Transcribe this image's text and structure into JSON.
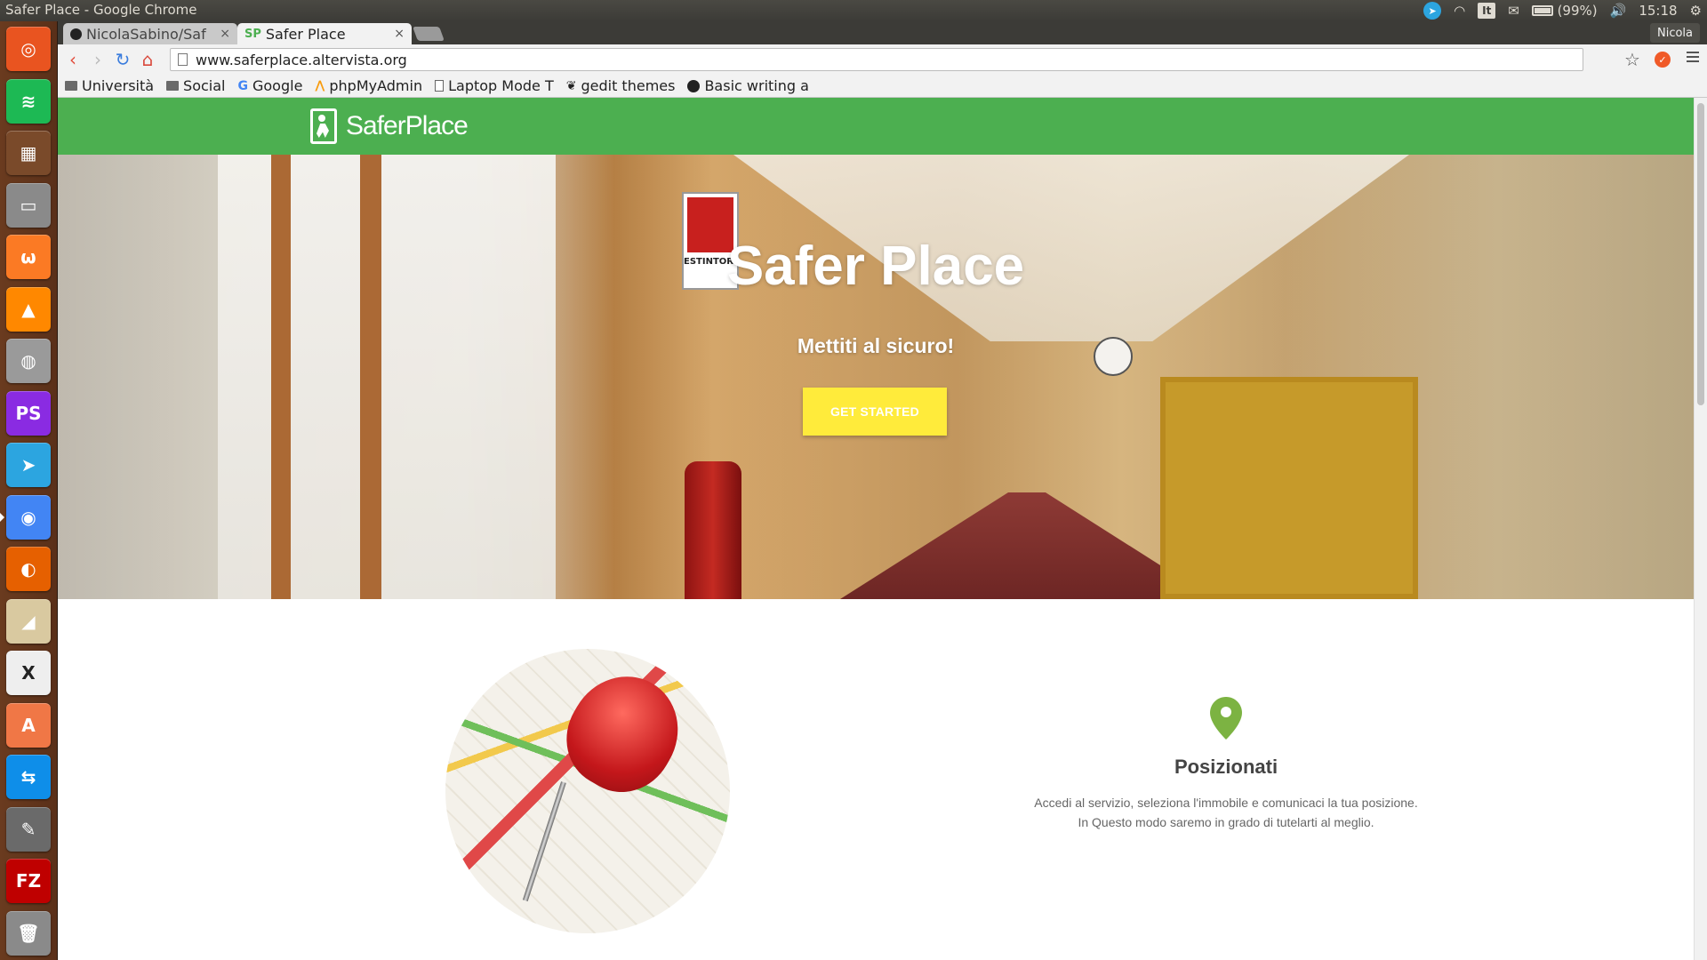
{
  "os": {
    "window_title": "Safer Place - Google Chrome",
    "battery": "(99%)",
    "clock": "15:18",
    "keyboard_layout": "It",
    "user": "Nicola"
  },
  "launcher": {
    "items": [
      {
        "name": "ubuntu-dash-icon",
        "color": "#e95420",
        "glyph": "◎"
      },
      {
        "name": "spotify-icon",
        "color": "#1db954",
        "glyph": "≋"
      },
      {
        "name": "workspace-switcher-icon",
        "color": "#7a4a2a",
        "glyph": "▦"
      },
      {
        "name": "files-icon",
        "color": "#8a8a8a",
        "glyph": "▭"
      },
      {
        "name": "xampp-icon",
        "color": "#fb7a24",
        "glyph": "ω"
      },
      {
        "name": "vlc-icon",
        "color": "#ff8800",
        "glyph": "▲"
      },
      {
        "name": "disk-icon",
        "color": "#9a9a9a",
        "glyph": "◍"
      },
      {
        "name": "phpstorm-icon",
        "color": "#8a2be2",
        "glyph": "PS"
      },
      {
        "name": "telegram-icon",
        "color": "#2ca5e0",
        "glyph": "➤"
      },
      {
        "name": "chrome-icon",
        "color": "#4285f4",
        "glyph": "◉"
      },
      {
        "name": "firefox-icon",
        "color": "#e66000",
        "glyph": "◐"
      },
      {
        "name": "impress-icon",
        "color": "#d9c9a0",
        "glyph": "◢"
      },
      {
        "name": "xmind-icon",
        "color": "#eeeeee",
        "glyph": "X"
      },
      {
        "name": "software-center-icon",
        "color": "#f07746",
        "glyph": "A"
      },
      {
        "name": "teamviewer-icon",
        "color": "#0e8ee9",
        "glyph": "⇆"
      },
      {
        "name": "tools-icon",
        "color": "#6a6a6a",
        "glyph": "✎"
      },
      {
        "name": "filezilla-icon",
        "color": "#bf0000",
        "glyph": "FZ"
      },
      {
        "name": "trash-icon",
        "color": "#8a8a8a",
        "glyph": "🗑"
      }
    ]
  },
  "browser": {
    "tabs": [
      {
        "label": "NicolaSabino/Saf"
      },
      {
        "label": "Safer Place"
      }
    ],
    "tab_close": "×",
    "url": "www.saferplace.altervista.org",
    "bookmarks": [
      {
        "label": "Università"
      },
      {
        "label": "Social"
      },
      {
        "label": "Google"
      },
      {
        "label": "phpMyAdmin"
      },
      {
        "label": "Laptop Mode T"
      },
      {
        "label": "gedit themes"
      },
      {
        "label": "Basic writing a"
      }
    ]
  },
  "site": {
    "brand": "SaferPlace",
    "hero": {
      "title": "Safer Place",
      "subtitle": "Mettiti al sicuro!",
      "cta": "GET STARTED",
      "sign_text": "ESTINTORE"
    },
    "feature": {
      "title": "Posizionati",
      "text_line1": "Accedi al servizio, seleziona l'immobile e comunicaci la tua posizione.",
      "text_line2": "In Questo modo saremo in grado di tutelarti al meglio."
    }
  },
  "colors": {
    "nav_green": "#4caf50",
    "cta_yellow": "#ffeb3b",
    "marker_green": "#7cb342"
  }
}
